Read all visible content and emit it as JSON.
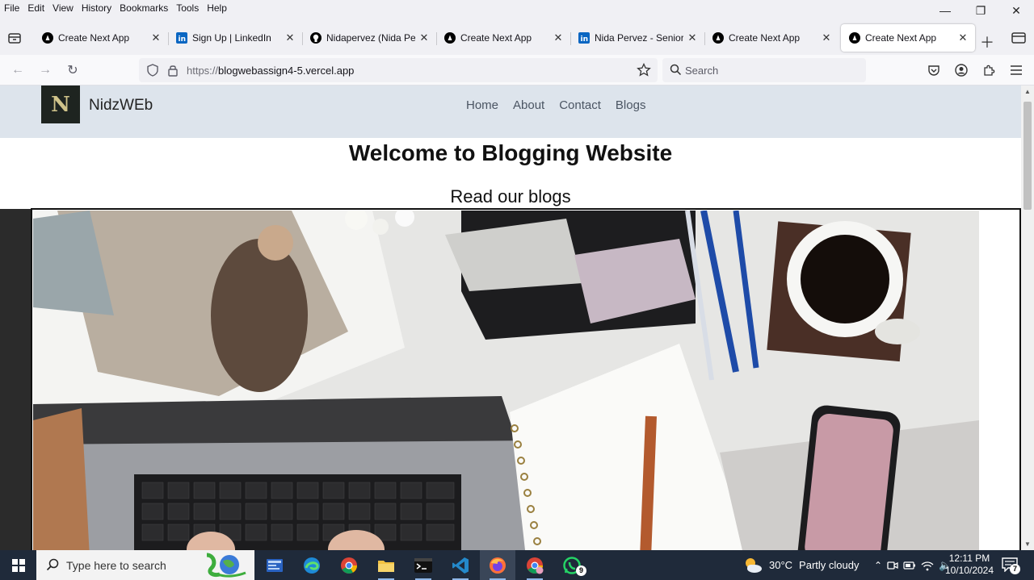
{
  "menu": [
    "File",
    "Edit",
    "View",
    "History",
    "Bookmarks",
    "Tools",
    "Help"
  ],
  "tabs": [
    {
      "title": "Create Next App",
      "icon": "nextjs-icon",
      "active": false
    },
    {
      "title": "Sign Up | LinkedIn",
      "icon": "linkedin-icon",
      "active": false
    },
    {
      "title": "Nidapervez (Nida Perve",
      "icon": "github-icon",
      "active": false
    },
    {
      "title": "Create Next App",
      "icon": "nextjs-icon",
      "active": false
    },
    {
      "title": "Nida Pervez - Senior St",
      "icon": "linkedin-icon",
      "active": false
    },
    {
      "title": "Create Next App",
      "icon": "nextjs-icon",
      "active": false
    },
    {
      "title": "Create Next App",
      "icon": "nextjs-icon",
      "active": true
    }
  ],
  "url": {
    "protocol": "https://",
    "host": "blogwebassign4-5.vercel.app"
  },
  "search": {
    "placeholder": "Search"
  },
  "site": {
    "logo_letter": "N",
    "name": "NidzWEb",
    "nav": [
      "Home",
      "About",
      "Contact",
      "Blogs"
    ],
    "heading": "Welcome to Blogging Website",
    "subheading": "Read our blogs"
  },
  "taskbar": {
    "search_placeholder": "Type here to search",
    "weather_temp": "30°C",
    "weather_desc": "Partly cloudy",
    "time": "12:11 PM",
    "date": "10/10/2024",
    "whatsapp_badge": "9",
    "notification_badge": "7"
  },
  "colors": {
    "header_bg": "#dde4ec",
    "taskbar_bg": "#1f2a3a",
    "active_tab": "#ffffff"
  }
}
